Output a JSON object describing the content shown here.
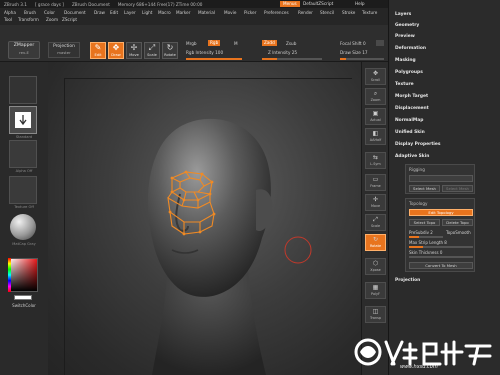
{
  "titlebar": {
    "segments": [
      "ZBrush 3.1",
      "[ grace days ]",
      "ZBrush Document",
      "Memory 686+144  Free(17)  ZTime 00:00"
    ],
    "memo": "Menus",
    "script": "DefaultZScript",
    "help": "Help"
  },
  "menubar": {
    "row1": [
      "Alpha",
      "Brush",
      "Color",
      "Document",
      "Draw",
      "Edit",
      "Layer",
      "Light",
      "Macro",
      "Marker",
      "Material",
      "Movie",
      "Picker",
      "Preferences",
      "Render",
      "Stencil",
      "Stroke",
      "Texture"
    ],
    "row2": [
      "Tool",
      "Transform",
      "Zoom",
      "ZScript"
    ]
  },
  "toptools": {
    "zmapper": "ZMapper",
    "zmapper_sub": "rev-E",
    "projection": "Projection",
    "projection_sub": "master",
    "tools": [
      "Edit",
      "Draw",
      "Move",
      "Scale",
      "Rotate"
    ],
    "mrgb": "Mrgb",
    "rgb": "Rgb",
    "m": "M",
    "rgb_intensity": "Rgb Intensity 100",
    "zadd": "Zadd",
    "zsub": "Zsub",
    "z_intensity": "Z Intensity 25",
    "focal_shift": "Focal Shift 0",
    "draw_size": "Draw Size 17"
  },
  "leftpanel": {
    "slot_labels": [
      "",
      "Standard",
      "Alpha Off",
      "Texture Off",
      "MatCap Gray"
    ],
    "switch_color": "SwitchColor",
    "main_color": "#ffffff"
  },
  "rightstrip": {
    "buttons": [
      "Scroll",
      "Zoom",
      "Actual",
      "AAHalf",
      "L.Sym",
      "Frame",
      "Move",
      "Scale",
      "Rotate",
      "Xpose",
      "PolyF",
      "Transp"
    ]
  },
  "rightpanel": {
    "menus": [
      "Layers",
      "Geometry",
      "Preview",
      "Deformation",
      "Masking",
      "Polygroups",
      "Texture",
      "Morph Target",
      "Displacement",
      "NormalMap",
      "Unified Skin",
      "Display Properties",
      "Adaptive Skin"
    ],
    "rigging": {
      "title": "Rigging",
      "select_mesh": "Select Mesh",
      "select_mesh2": "Select Mesh"
    },
    "topology": {
      "title": "Topology",
      "edit_topology": "Edit Topology",
      "select_topo": "Select Topo",
      "delete_topo": "Delete Topo",
      "pre_subdiv": "PreSubdiv 2",
      "topo_smooth": "TopoSmooth",
      "max_strip_length": "Max Strip Length 8",
      "skin_thickness": "Skin Thickness 0",
      "convert_to_mesh": "Convert To Mesh"
    },
    "projection": "Projection"
  },
  "watermark": {
    "url": "www.hxsd.com"
  },
  "colors": {
    "accent": "#e8741e",
    "panel": "#2b2b2b"
  }
}
